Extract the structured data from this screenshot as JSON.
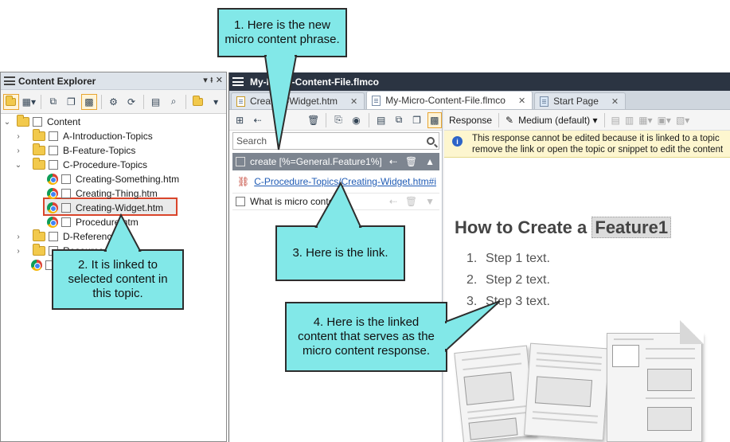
{
  "content_explorer": {
    "title": "Content Explorer",
    "pin_glyph": "▾  ⭻  ✕",
    "tree": [
      {
        "label": "Content",
        "level": 0,
        "kind": "folder",
        "expanded": true
      },
      {
        "label": "A-Introduction-Topics",
        "level": 1,
        "kind": "folder",
        "expanded": false
      },
      {
        "label": "B-Feature-Topics",
        "level": 1,
        "kind": "folder",
        "expanded": false
      },
      {
        "label": "C-Procedure-Topics",
        "level": 1,
        "kind": "folder",
        "expanded": true
      },
      {
        "label": "Creating-Something.htm",
        "level": 2,
        "kind": "file"
      },
      {
        "label": "Creating-Thing.htm",
        "level": 2,
        "kind": "file"
      },
      {
        "label": "Creating-Widget.htm",
        "level": 2,
        "kind": "file",
        "selected": true
      },
      {
        "label": "Procedure.htm",
        "level": 2,
        "kind": "file"
      },
      {
        "label": "D-Reference",
        "level": 1,
        "kind": "folder",
        "expanded": false
      },
      {
        "label": "Resources",
        "level": 1,
        "kind": "folder",
        "expanded": false
      },
      {
        "label": "",
        "level": 0,
        "kind": "file"
      }
    ]
  },
  "editor": {
    "window_title": "My-Micro-Content-File.flmco",
    "tabs": [
      {
        "label": "Creating-Widget.htm",
        "active": false
      },
      {
        "label": "My-Micro-Content-File.flmco",
        "active": true
      },
      {
        "label": "Start Page",
        "active": false
      }
    ],
    "search_placeholder": "Search",
    "phrase": "create [%=General.Feature1%]",
    "link": "C-Procedure-Topics/Creating-Widget.htm#i",
    "question": "What is micro content?",
    "response_label": "Response",
    "medium_label": "Medium (default)",
    "info_line1": "This response cannot be edited because it is linked to a topic",
    "info_line2": "remove the link or open the topic or snippet to edit the content",
    "heading_prefix": "How to Create a ",
    "heading_var": "Feature1",
    "steps": [
      "Step 1 text.",
      "Step 2 text.",
      "Step 3 text."
    ],
    "step_numbers": [
      "1.",
      "2.",
      "3."
    ]
  },
  "callouts": {
    "c1": "1. Here is the new micro content phrase.",
    "c2": "2. It is linked to selected content in this topic.",
    "c3": "3. Here is the link.",
    "c4": "4. Here is the linked content that serves as the micro content response."
  },
  "colors": {
    "callout": "#82e8e8",
    "selection_border": "#d9452b",
    "link": "#1f5bb5",
    "titlebar": "#2b3442"
  }
}
